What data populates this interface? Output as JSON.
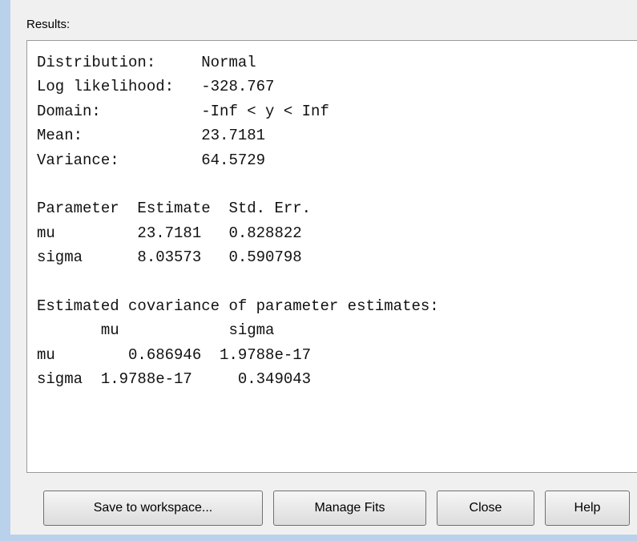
{
  "results_label": "Results:",
  "results_lines": [
    "Distribution:     Normal",
    "Log likelihood:   -328.767",
    "Domain:           -Inf < y < Inf",
    "Mean:             23.7181",
    "Variance:         64.5729",
    "",
    "Parameter  Estimate  Std. Err.",
    "mu         23.7181   0.828822",
    "sigma      8.03573   0.590798",
    "",
    "Estimated covariance of parameter estimates:",
    "       mu            sigma",
    "mu        0.686946  1.9788e-17",
    "sigma  1.9788e-17     0.349043"
  ],
  "buttons": {
    "save": "Save to workspace...",
    "manage": "Manage Fits",
    "close": "Close",
    "help": "Help"
  },
  "colors": {
    "frame": "#b9d1ea",
    "panel": "#f0f0f0",
    "text_area": "#ffffff"
  }
}
